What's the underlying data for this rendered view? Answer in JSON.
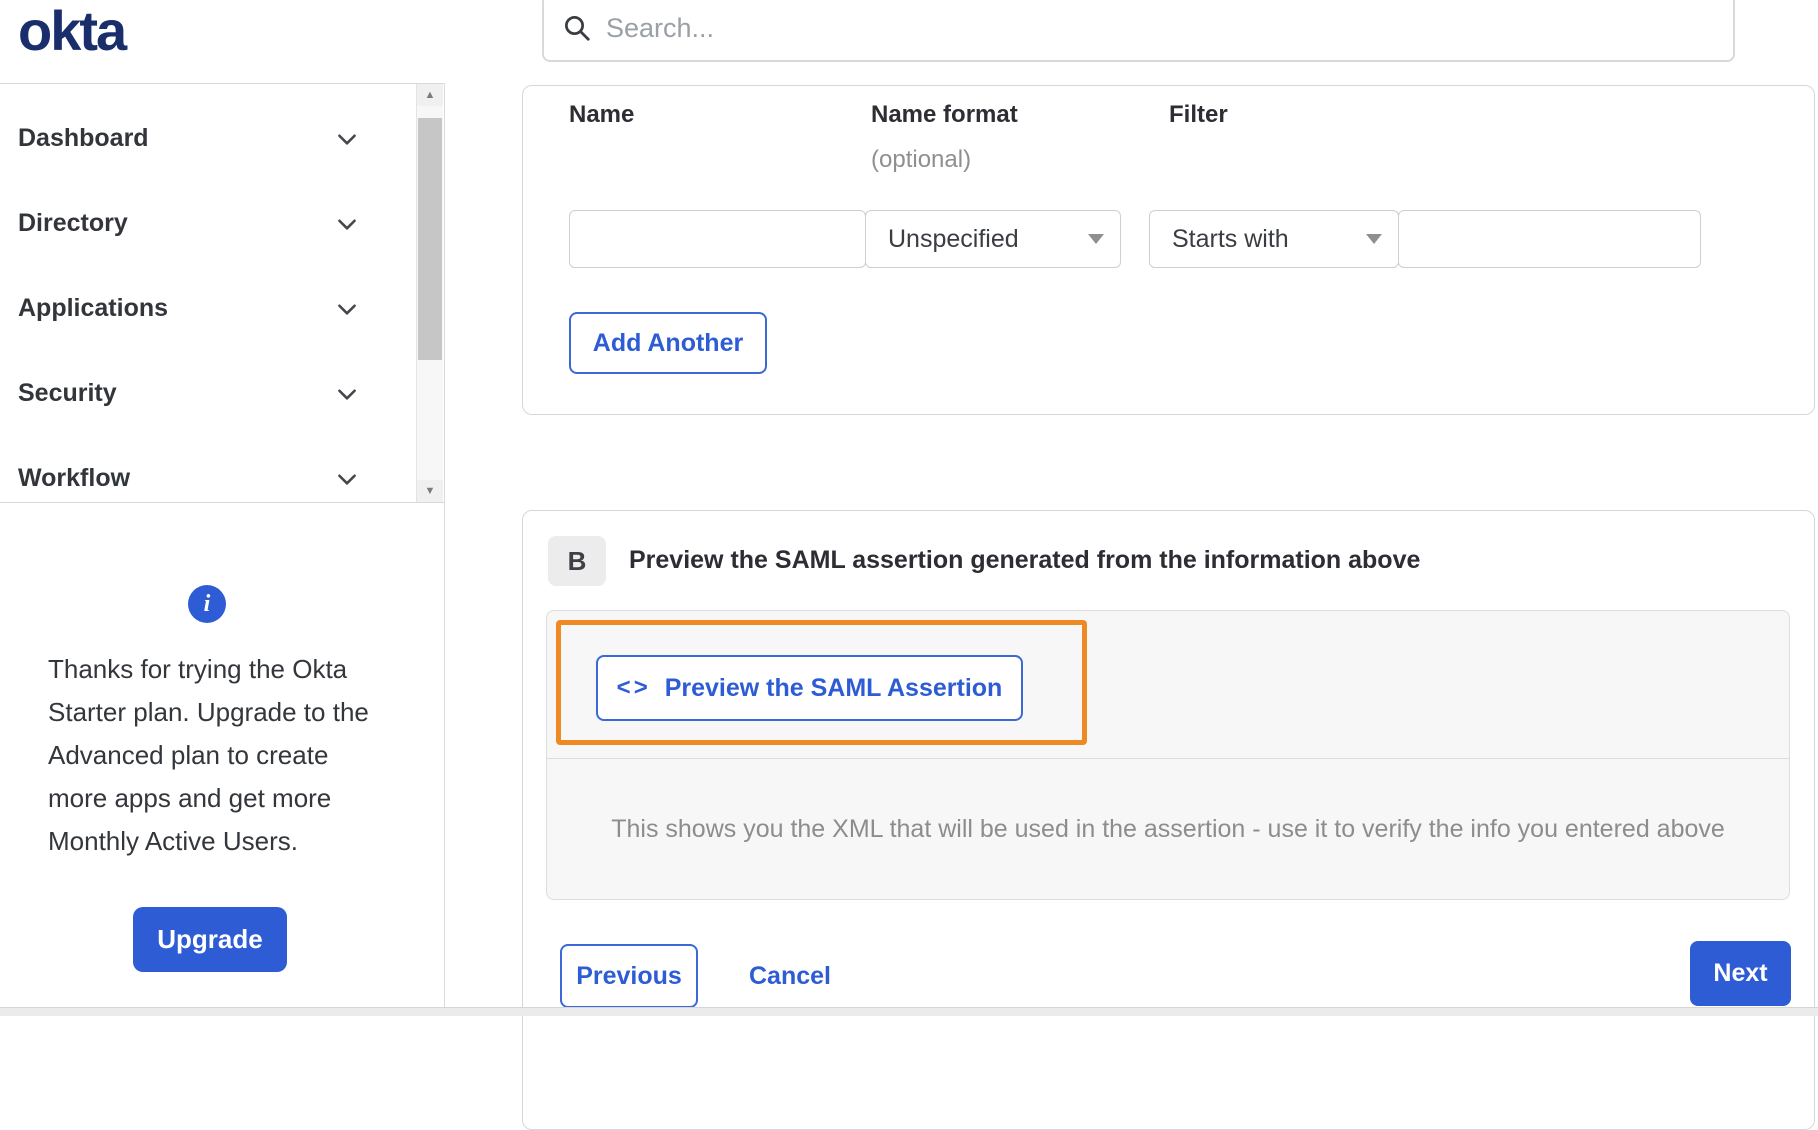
{
  "brand": {
    "logo_text": "okta"
  },
  "search": {
    "placeholder": "Search..."
  },
  "sidebar": {
    "items": [
      {
        "label": "Dashboard"
      },
      {
        "label": "Directory"
      },
      {
        "label": "Applications"
      },
      {
        "label": "Security"
      },
      {
        "label": "Workflow"
      }
    ]
  },
  "upgrade_panel": {
    "info_glyph": "i",
    "message": "Thanks for trying the Okta Starter plan. Upgrade to the Advanced plan to create more apps and get more Monthly Active Users.",
    "button_label": "Upgrade"
  },
  "attribute_form": {
    "columns": {
      "name_label": "Name",
      "name_format_label": "Name format",
      "name_format_hint": "(optional)",
      "filter_label": "Filter"
    },
    "name_value": "",
    "name_format_selected": "Unspecified",
    "filter_operator_selected": "Starts with",
    "filter_value": "",
    "add_another_label": "Add Another"
  },
  "preview_section": {
    "step_label": "B",
    "title": "Preview the SAML assertion generated from the information above",
    "code_glyph": "<>",
    "preview_button_label": "Preview the SAML Assertion",
    "description": "This shows you the XML that will be used in the assertion - use it to verify the info you entered above"
  },
  "footer": {
    "previous_label": "Previous",
    "cancel_label": "Cancel",
    "next_label": "Next"
  },
  "colors": {
    "brand_navy": "#192e6b",
    "accent_blue": "#2d5cd5",
    "highlight_orange": "#ee8a23",
    "panel_gray": "#f7f7f7",
    "border_gray": "#d7d7d7"
  }
}
